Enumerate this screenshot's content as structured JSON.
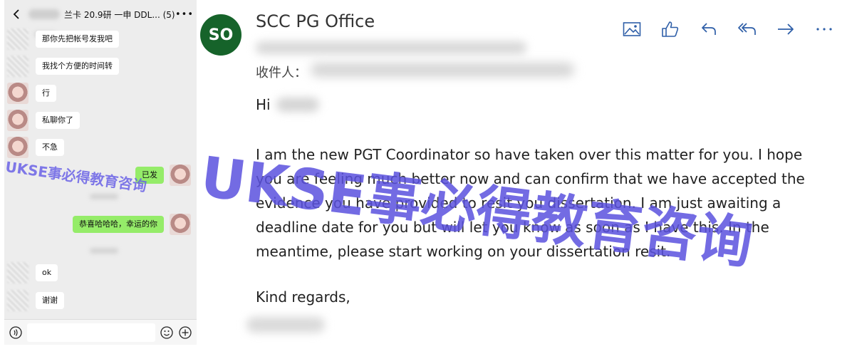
{
  "chat": {
    "title": "兰卡 20.9研 一申 DDL... (5)",
    "messages": [
      {
        "side": "in",
        "text": "那你先把帐号发我吧"
      },
      {
        "side": "in",
        "text": "我找个方便的时间转"
      },
      {
        "side": "in",
        "text": "行"
      },
      {
        "side": "in",
        "text": "私聊你了"
      },
      {
        "side": "in",
        "text": "不急"
      },
      {
        "side": "out",
        "text": "已发"
      },
      {
        "side": "out",
        "text": "恭喜哈哈哈，幸运的你"
      },
      {
        "side": "in",
        "text": "ok"
      },
      {
        "side": "in",
        "text": "谢谢"
      }
    ],
    "watermark": "UKSE事必得教育咨询"
  },
  "email": {
    "avatar_initials": "SO",
    "avatar_color": "#16632a",
    "sender": "SCC PG Office",
    "recipient_label": "收件人：",
    "greeting": "Hi",
    "body_lines": [
      "I am the new PGT Coordinator so have taken over this matter for you. I hope",
      "you are feeling much better now and can confirm that we have accepted the",
      "evidence you have provided to resit you dissertation. I am just awaiting a",
      "deadline date for you but will let you know as soon as I have this. In the",
      "meantime, please start working on your dissertation resit."
    ],
    "signoff": "Kind regards,",
    "toolbar_icons": [
      "image-icon",
      "thumbs-up-icon",
      "reply-icon",
      "reply-all-icon",
      "forward-icon",
      "more-icon"
    ]
  },
  "watermark": "UKSE事必得教育咨询",
  "colors": {
    "watermark": "#5b52df",
    "outgoing_bubble": "#95ec69",
    "toolbar_icon": "#2f5fa8"
  }
}
